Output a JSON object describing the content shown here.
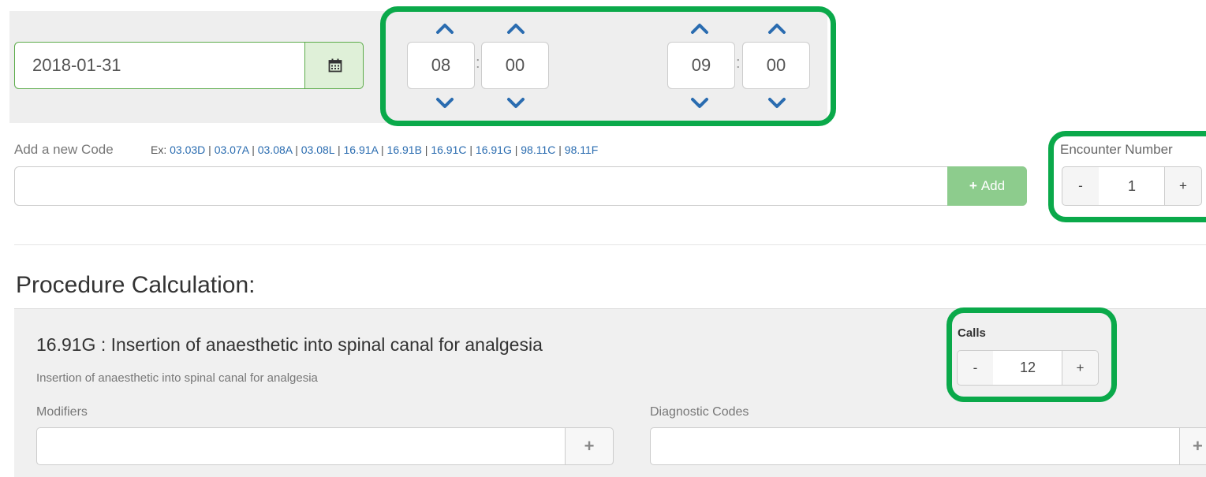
{
  "datetime": {
    "date_value": "2018-01-31",
    "start_hour": "08",
    "start_minute": "00",
    "end_hour": "09",
    "end_minute": "00",
    "separator": ":",
    "calendar_icon": "calendar-icon",
    "up_icon": "chevron-up-icon",
    "down_icon": "chevron-down-icon"
  },
  "code_entry": {
    "label": "Add a new Code",
    "example_prefix": "Ex: ",
    "example_codes": [
      "03.03D",
      "03.07A",
      "03.08A",
      "03.08L",
      "16.91A",
      "16.91B",
      "16.91C",
      "16.91G",
      "98.11C",
      "98.11F"
    ],
    "example_separator": " | ",
    "input_value": "",
    "add_icon": "+",
    "add_label": "Add"
  },
  "encounter": {
    "label": "Encounter Number",
    "minus": "-",
    "value": "1",
    "plus": "+"
  },
  "procedure": {
    "section_title": "Procedure Calculation:",
    "title": "16.91G : Insertion of anaesthetic into spinal canal for analgesia",
    "description": "Insertion of anaesthetic into spinal canal for analgesia",
    "calls": {
      "label": "Calls",
      "minus": "-",
      "value": "12",
      "plus": "+"
    },
    "modifiers_label": "Modifiers",
    "modifiers_value": "",
    "modifiers_add": "+",
    "diagnostic_label": "Diagnostic Codes",
    "diagnostic_value": "",
    "diagnostic_add": "+"
  },
  "colors": {
    "highlight": "#0aa94a",
    "chevron": "#2a6cb0",
    "link": "#2a6cb0",
    "add_button": "#8dcc8d",
    "date_border": "#5cab4a"
  }
}
